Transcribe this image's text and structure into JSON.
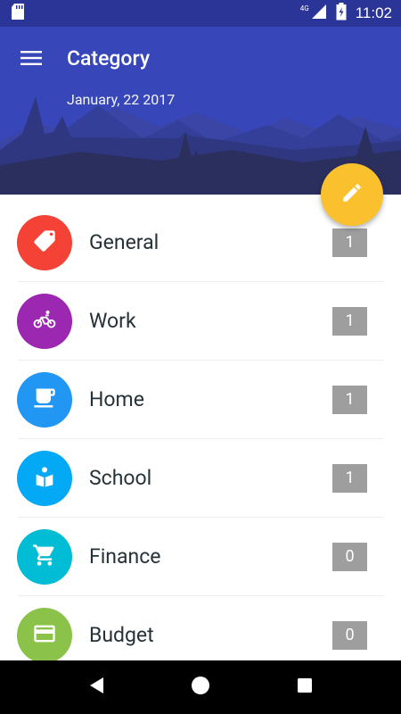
{
  "status_bar": {
    "network": "4G",
    "time": "11:02"
  },
  "header": {
    "title": "Category",
    "date": "January, 22 2017"
  },
  "fab": {
    "icon": "pencil-icon",
    "color": "#fbc02d"
  },
  "categories": [
    {
      "name": "General",
      "count": "1",
      "icon": "tag-icon",
      "color": "#f44336"
    },
    {
      "name": "Work",
      "count": "1",
      "icon": "bicycle-icon",
      "color": "#9c27b0"
    },
    {
      "name": "Home",
      "count": "1",
      "icon": "coffee-cup-icon",
      "color": "#2196f3"
    },
    {
      "name": "School",
      "count": "1",
      "icon": "school-icon",
      "color": "#03a9f4"
    },
    {
      "name": "Finance",
      "count": "0",
      "icon": "cart-icon",
      "color": "#00bcd4"
    },
    {
      "name": "Budget",
      "count": "0",
      "icon": "credit-card-icon",
      "color": "#8bc34a"
    }
  ]
}
